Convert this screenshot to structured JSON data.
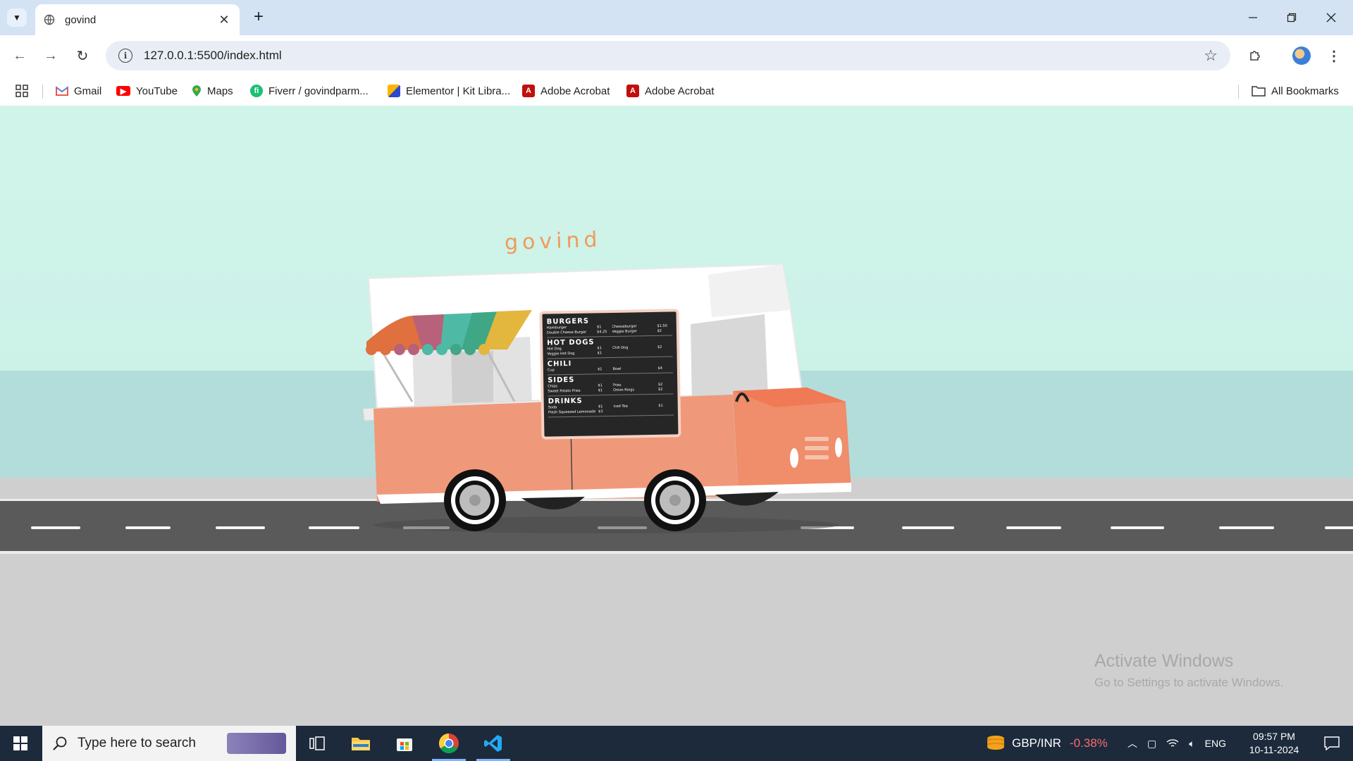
{
  "browser": {
    "tab_title": "govind",
    "url": "127.0.0.1:5500/index.html",
    "bookmarks": [
      {
        "label": "Gmail",
        "icon": "gmail-icon"
      },
      {
        "label": "YouTube",
        "icon": "youtube-icon"
      },
      {
        "label": "Maps",
        "icon": "maps-icon"
      },
      {
        "label": "Fiverr / govindparm...",
        "icon": "fiverr-icon"
      },
      {
        "label": "Elementor | Kit Libra...",
        "icon": "elementor-icon"
      },
      {
        "label": "Adobe Acrobat",
        "icon": "acrobat-icon"
      },
      {
        "label": "Adobe Acrobat",
        "icon": "acrobat-icon"
      }
    ],
    "all_bookmarks": "All Bookmarks"
  },
  "truck": {
    "brand": "govind",
    "menu": [
      {
        "heading": "BURGERS",
        "rows": [
          [
            "Hamburger",
            "$1",
            "Cheeseburger",
            "$1.50"
          ],
          [
            "Double Cheese Burger",
            "$4.25",
            "Veggie Burger",
            "$2"
          ]
        ]
      },
      {
        "heading": "HOT DOGS",
        "rows": [
          [
            "Hot Dog",
            "$1",
            "Chili Dog",
            "$2"
          ],
          [
            "Veggie Hot Dog",
            "$1",
            "",
            ""
          ]
        ]
      },
      {
        "heading": "CHILI",
        "rows": [
          [
            "Cup",
            "$1",
            "Bowl",
            "$4"
          ]
        ]
      },
      {
        "heading": "SIDES",
        "rows": [
          [
            "Chips",
            "$1",
            "Fries",
            "$2"
          ],
          [
            "Sweet Potato Fries",
            "$1",
            "Onion Rings",
            "$2"
          ]
        ]
      },
      {
        "heading": "DRINKS",
        "rows": [
          [
            "Soda",
            "$1",
            "Iced Tea",
            "$1"
          ],
          [
            "Fresh Squeezed Lemonade",
            "$3",
            "",
            ""
          ]
        ]
      }
    ]
  },
  "watermark": {
    "title": "Activate Windows",
    "subtitle": "Go to Settings to activate Windows."
  },
  "taskbar": {
    "search_placeholder": "Type here to search",
    "ticker_label": "GBP/INR",
    "ticker_change": "-0.38%",
    "language": "ENG",
    "time": "09:57 PM",
    "date": "10-11-2024"
  },
  "colors": {
    "sky": "#d1f4ea",
    "sea": "#b3ddda",
    "road": "#5a5a5a",
    "truck_body": "#f0997a",
    "truck_top": "#ffffff",
    "brand_text": "#f09a5b",
    "ticker_negative": "#ff6b6b"
  }
}
